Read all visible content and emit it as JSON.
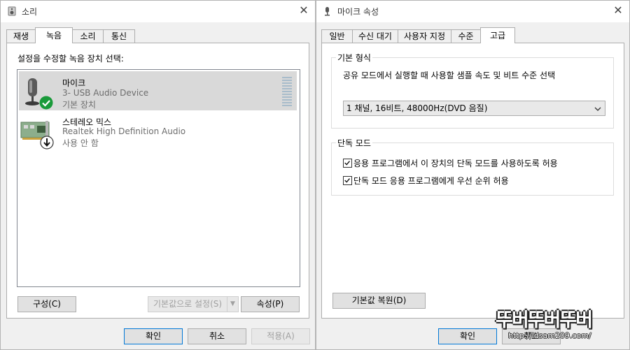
{
  "sound_dialog": {
    "title": "소리",
    "tabs": [
      {
        "label": "재생"
      },
      {
        "label": "녹음"
      },
      {
        "label": "소리"
      },
      {
        "label": "통신"
      }
    ],
    "active_tab": "녹음",
    "instruction": "설정을 수정할 녹음 장치 선택:",
    "devices": [
      {
        "name": "마이크",
        "description": "3- USB Audio Device",
        "status": "기본 장치",
        "icon": "microphone-icon",
        "badge": "default-check-badge",
        "selected": true
      },
      {
        "name": "스테레오 믹스",
        "description": "Realtek High Definition Audio",
        "status": "사용 안 함",
        "icon": "sound-card-icon",
        "badge": "disabled-arrow-badge",
        "selected": false
      }
    ],
    "configure_button": "구성(C)",
    "set_default_button": "기본값으로 설정(S)",
    "properties_button": "속성(P)",
    "ok_button": "확인",
    "cancel_button": "취소",
    "apply_button": "적용(A)"
  },
  "mic_properties": {
    "title": "마이크 속성",
    "tabs": [
      {
        "label": "일반"
      },
      {
        "label": "수신 대기"
      },
      {
        "label": "사용자 지정"
      },
      {
        "label": "수준"
      },
      {
        "label": "고급"
      }
    ],
    "active_tab": "고급",
    "default_format": {
      "group_label": "기본 형식",
      "description": "공유 모드에서 실행할 때 사용할 샘플 속도 및 비트 수준 선택",
      "selected_format": "1 채널, 16비트, 48000Hz(DVD 음질)"
    },
    "exclusive_mode": {
      "group_label": "단독 모드",
      "option1": "응용 프로그램에서 이 장치의 단독 모드를 사용하도록 허용",
      "option1_checked": true,
      "option2": "단독 모드 응용 프로그램에게 우선 순위 허용",
      "option2_checked": true
    },
    "restore_defaults_button": "기본값 복원(D)",
    "ok_button": "확인",
    "cancel_button": "취소"
  },
  "watermark": {
    "logo_text": "뚜버뚜버뚜버",
    "url": "http://ldsam209.com/"
  },
  "colors": {
    "selection": "#cce8ff",
    "check_badge": "#1a9a3a",
    "dialog_bg": "#f0f0f0"
  }
}
